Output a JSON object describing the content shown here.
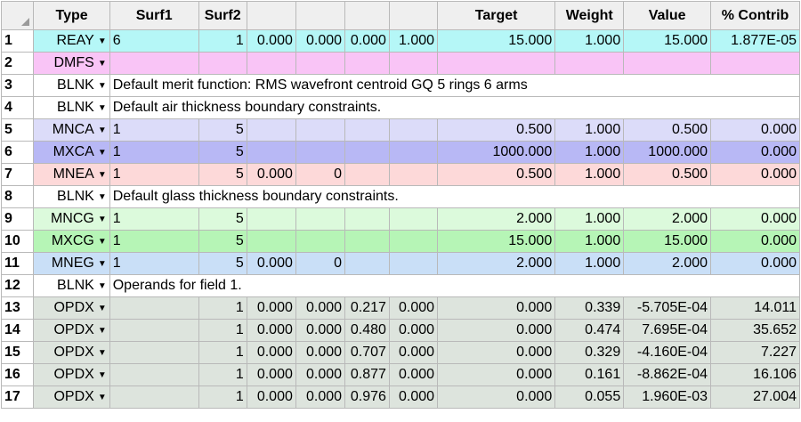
{
  "headers": [
    "",
    "Type",
    "Surf1",
    "Surf2",
    "",
    "",
    "",
    "",
    "Target",
    "Weight",
    "Value",
    "% Contrib"
  ],
  "rows": [
    {
      "num": "1",
      "type": "REAY",
      "color": "#b5f7f7",
      "comment": null,
      "cells": [
        "6",
        "1",
        "0.000",
        "0.000",
        "0.000",
        "1.000",
        "15.000",
        "1.000",
        "15.000",
        "1.877E-05"
      ]
    },
    {
      "num": "2",
      "type": "DMFS",
      "color": "#f9c4f6",
      "comment": null,
      "cells": [
        "",
        "",
        "",
        "",
        "",
        "",
        "",
        "",
        "",
        ""
      ]
    },
    {
      "num": "3",
      "type": "BLNK",
      "color": "#ffffff",
      "comment": "Default merit function: RMS wavefront centroid GQ 5 rings 6 arms"
    },
    {
      "num": "4",
      "type": "BLNK",
      "color": "#ffffff",
      "comment": "Default air thickness boundary constraints."
    },
    {
      "num": "5",
      "type": "MNCA",
      "color": "#dcdcf9",
      "comment": null,
      "cells": [
        "1",
        "5",
        "",
        "",
        "",
        "",
        "0.500",
        "1.000",
        "0.500",
        "0.000"
      ]
    },
    {
      "num": "6",
      "type": "MXCA",
      "color": "#b8b8f5",
      "comment": null,
      "cells": [
        "1",
        "5",
        "",
        "",
        "",
        "",
        "1000.000",
        "1.000",
        "1000.000",
        "0.000"
      ]
    },
    {
      "num": "7",
      "type": "MNEA",
      "color": "#fdd9d9",
      "comment": null,
      "cells": [
        "1",
        "5",
        "0.000",
        "0",
        "",
        "",
        "0.500",
        "1.000",
        "0.500",
        "0.000"
      ]
    },
    {
      "num": "8",
      "type": "BLNK",
      "color": "#ffffff",
      "comment": "Default glass thickness boundary constraints."
    },
    {
      "num": "9",
      "type": "MNCG",
      "color": "#dcfadc",
      "comment": null,
      "cells": [
        "1",
        "5",
        "",
        "",
        "",
        "",
        "2.000",
        "1.000",
        "2.000",
        "0.000"
      ]
    },
    {
      "num": "10",
      "type": "MXCG",
      "color": "#b6f5b6",
      "comment": null,
      "cells": [
        "1",
        "5",
        "",
        "",
        "",
        "",
        "15.000",
        "1.000",
        "15.000",
        "0.000"
      ]
    },
    {
      "num": "11",
      "type": "MNEG",
      "color": "#c9dff7",
      "comment": null,
      "cells": [
        "1",
        "5",
        "0.000",
        "0",
        "",
        "",
        "2.000",
        "1.000",
        "2.000",
        "0.000"
      ]
    },
    {
      "num": "12",
      "type": "BLNK",
      "color": "#ffffff",
      "comment": "Operands for field 1."
    },
    {
      "num": "13",
      "type": "OPDX",
      "color": "#dde4dd",
      "comment": null,
      "cells": [
        "",
        "1",
        "0.000",
        "0.000",
        "0.217",
        "0.000",
        "0.000",
        "0.339",
        "-5.705E-04",
        "14.011"
      ]
    },
    {
      "num": "14",
      "type": "OPDX",
      "color": "#dde4dd",
      "comment": null,
      "cells": [
        "",
        "1",
        "0.000",
        "0.000",
        "0.480",
        "0.000",
        "0.000",
        "0.474",
        "7.695E-04",
        "35.652"
      ]
    },
    {
      "num": "15",
      "type": "OPDX",
      "color": "#dde4dd",
      "comment": null,
      "cells": [
        "",
        "1",
        "0.000",
        "0.000",
        "0.707",
        "0.000",
        "0.000",
        "0.329",
        "-4.160E-04",
        "7.227"
      ]
    },
    {
      "num": "16",
      "type": "OPDX",
      "color": "#dde4dd",
      "comment": null,
      "cells": [
        "",
        "1",
        "0.000",
        "0.000",
        "0.877",
        "0.000",
        "0.000",
        "0.161",
        "-8.862E-04",
        "16.106"
      ]
    },
    {
      "num": "17",
      "type": "OPDX",
      "color": "#dde4dd",
      "comment": null,
      "cells": [
        "",
        "1",
        "0.000",
        "0.000",
        "0.976",
        "0.000",
        "0.000",
        "0.055",
        "1.960E-03",
        "27.004"
      ]
    }
  ]
}
